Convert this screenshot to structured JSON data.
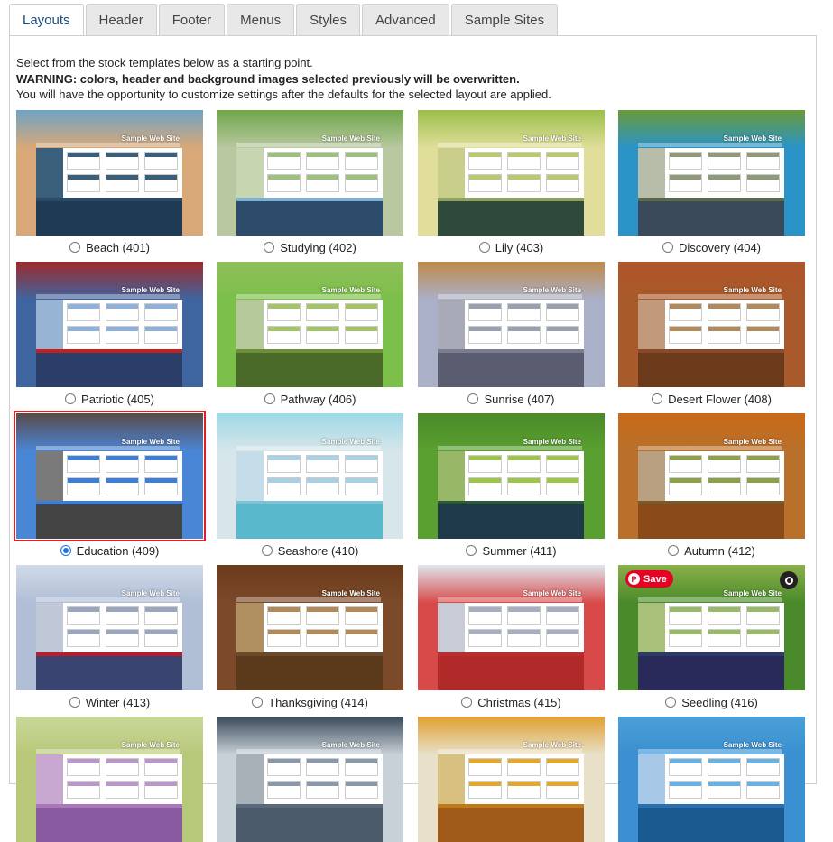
{
  "tabs": [
    {
      "label": "Layouts",
      "active": true
    },
    {
      "label": "Header"
    },
    {
      "label": "Footer"
    },
    {
      "label": "Menus"
    },
    {
      "label": "Styles"
    },
    {
      "label": "Advanced"
    },
    {
      "label": "Sample Sites"
    }
  ],
  "intro": {
    "line1": "Select from the stock templates below as a starting point.",
    "warning": "WARNING: colors, header and background images selected previously will be overwritten.",
    "line3": "You will have the opportunity to customize settings after the defaults for the selected layout are applied."
  },
  "thumb_title": "Sample Web Site",
  "layouts": [
    {
      "label": "Beach (401)",
      "colors": {
        "hdr": "#6fa3c4",
        "bg": "#d9a878",
        "side": "#3a5f7a",
        "box": "#3a5f7a",
        "bar": "#2a4a66",
        "foot": "#1e3a55"
      }
    },
    {
      "label": "Studying (402)",
      "colors": {
        "hdr": "#6fa64a",
        "bg": "#b9c8a0",
        "side": "#c7d5b0",
        "box": "#9cc07e",
        "bar": "#7fb0d0",
        "foot": "#2c4a6a"
      }
    },
    {
      "label": "Lily (403)",
      "colors": {
        "hdr": "#9bbf4a",
        "bg": "#e0de9a",
        "side": "#c9cf8a",
        "box": "#b8c970",
        "bar": "#8fa060",
        "foot": "#2f4a3a"
      }
    },
    {
      "label": "Discovery (404)",
      "colors": {
        "hdr": "#6a9a3a",
        "bg": "#2a93c8",
        "side": "#b7bda8",
        "box": "#8f9a7a",
        "bar": "#5a6a4a",
        "foot": "#3a4a5a"
      }
    },
    {
      "label": "Patriotic (405)",
      "colors": {
        "hdr": "#9c2a2a",
        "bg": "#3f65a0",
        "side": "#98b4d4",
        "box": "#8fb0d8",
        "bar": "#c02020",
        "foot": "#2b3e6a"
      }
    },
    {
      "label": "Pathway (406)",
      "colors": {
        "hdr": "#8fbf5a",
        "bg": "#7cbf4a",
        "side": "#b6c99a",
        "box": "#a5c46a",
        "bar": "#6d8f3a",
        "foot": "#4a6a2a"
      }
    },
    {
      "label": "Sunrise (407)",
      "colors": {
        "hdr": "#c08a4a",
        "bg": "#aab0c8",
        "side": "#a8aab8",
        "box": "#9aa0b0",
        "bar": "#7a7c90",
        "foot": "#5a5c70"
      }
    },
    {
      "label": "Desert Flower (408)",
      "colors": {
        "hdr": "#b0542a",
        "bg": "#a85a2a",
        "side": "#c09a7a",
        "box": "#b08a5a",
        "bar": "#8a4a2a",
        "foot": "#6a3a1a"
      }
    },
    {
      "label": "Education (409)",
      "colors": {
        "hdr": "#5a4a4a",
        "bg": "#4a86d6",
        "side": "#7a7a7a",
        "box": "#3d7fd8",
        "bar": "#3d7fd8",
        "foot": "#444444"
      }
    },
    {
      "label": "Seashore (410)",
      "colors": {
        "hdr": "#9ed8e6",
        "bg": "#d6e6ea",
        "side": "#c5dde8",
        "box": "#a8cfe3",
        "bar": "#7ac4d6",
        "foot": "#5ab8cc"
      }
    },
    {
      "label": "Summer (411)",
      "colors": {
        "hdr": "#4a8a2a",
        "bg": "#5aa030",
        "side": "#98b868",
        "box": "#9cc54a",
        "bar": "#2a5a3a",
        "foot": "#1e3a4a"
      }
    },
    {
      "label": "Autumn (412)",
      "colors": {
        "hdr": "#c86a1a",
        "bg": "#b8702a",
        "side": "#b8a080",
        "box": "#8aa04a",
        "bar": "#7a5a2a",
        "foot": "#8a4a1a"
      }
    },
    {
      "label": "Winter (413)",
      "colors": {
        "hdr": "#d0dae8",
        "bg": "#b0bed6",
        "side": "#c0c8d8",
        "box": "#9aa6be",
        "bar": "#c01a2a",
        "foot": "#3a4470"
      }
    },
    {
      "label": "Thanksgiving (414)",
      "colors": {
        "hdr": "#6a3a1a",
        "bg": "#7a4a2a",
        "side": "#b09060",
        "box": "#b08a5a",
        "bar": "#6a4a2a",
        "foot": "#5a3a1a"
      }
    },
    {
      "label": "Christmas (415)",
      "colors": {
        "hdr": "#e0e6ee",
        "bg": "#d84a4a",
        "side": "#c8ccd6",
        "box": "#a8aec0",
        "bar": "#c02a2a",
        "foot": "#b02a2a"
      }
    },
    {
      "label": "Seedling (416)",
      "colors": {
        "hdr": "#8ab04a",
        "bg": "#4a8a2a",
        "side": "#a8c07a",
        "box": "#98b86a",
        "bar": "#2a3a6a",
        "foot": "#2a2a5a"
      }
    },
    {
      "label": "",
      "colors": {
        "hdr": "#c8d89a",
        "bg": "#b8c87a",
        "side": "#c8a8d0",
        "box": "#b898c8",
        "bar": "#a878b8",
        "foot": "#8a5aa0"
      }
    },
    {
      "label": "",
      "colors": {
        "hdr": "#3a4a5a",
        "bg": "#c8d0d8",
        "side": "#a8b0b8",
        "box": "#8a98a8",
        "bar": "#5a6a7a",
        "foot": "#4a5a6a"
      }
    },
    {
      "label": "",
      "colors": {
        "hdr": "#e0a030",
        "bg": "#e8e0c8",
        "side": "#d8c080",
        "box": "#e0a830",
        "bar": "#c07a1a",
        "foot": "#a05a1a"
      }
    },
    {
      "label": "",
      "colors": {
        "hdr": "#4aa0d8",
        "bg": "#3a90d0",
        "side": "#a8c8e8",
        "box": "#6ab0e0",
        "bar": "#2a70b0",
        "foot": "#1a5a90"
      }
    }
  ],
  "selected_index": 8,
  "pin_save_label": "Save",
  "icons": {
    "pinterest": "pinterest-icon",
    "lens": "lens-search-icon"
  }
}
